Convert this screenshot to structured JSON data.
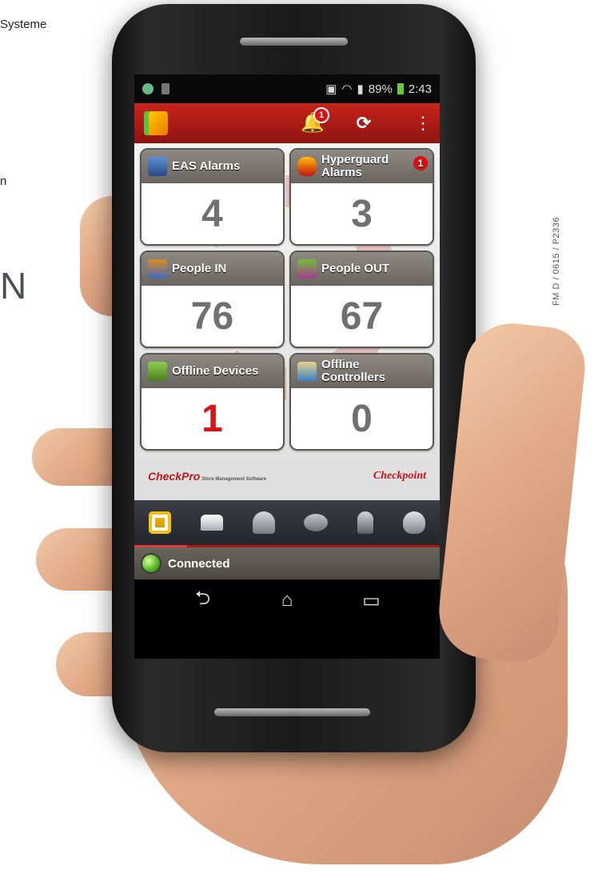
{
  "page": {
    "partial_text_top": "Systeme",
    "partial_text_mid": "n",
    "partial_text_large": "N",
    "side_code": "FM D / 0615 / P2336"
  },
  "status_bar": {
    "battery": "89%",
    "time": "2:43"
  },
  "app_bar": {
    "notification_count": "1",
    "logo_icon": "app-logo-icon",
    "icons": [
      "bell-icon",
      "refresh-icon",
      "overflow-menu-icon"
    ]
  },
  "tiles": [
    {
      "label": "EAS Alarms",
      "value": "4",
      "icon": "eas-alarm-icon"
    },
    {
      "label": "Hyperguard Alarms",
      "value": "3",
      "icon": "hyperguard-icon",
      "badge": "1"
    },
    {
      "label": "People IN",
      "value": "76",
      "icon": "people-in-icon"
    },
    {
      "label": "People OUT",
      "value": "67",
      "icon": "people-out-icon"
    },
    {
      "label": "Offline Devices",
      "value": "1",
      "icon": "offline-devices-icon",
      "value_color": "#d81414"
    },
    {
      "label": "Offline Controllers",
      "value": "0",
      "icon": "offline-controllers-icon"
    }
  ],
  "branding": {
    "left": "CheckPro",
    "left_sub": "Store Management Software",
    "right": "Checkpoint"
  },
  "bottom_nav": [
    "dashboard-icon",
    "readers-icon",
    "alarm-bell-icon",
    "people-icon",
    "hyperguard-icon",
    "users-icon"
  ],
  "connection": {
    "status": "Connected",
    "color": "#4fb020"
  },
  "android_nav": {
    "back": "⮌",
    "home": "⌂",
    "recent": "▭"
  },
  "colors": {
    "app_bar": "#c8241c",
    "accent_red": "#d81414"
  }
}
